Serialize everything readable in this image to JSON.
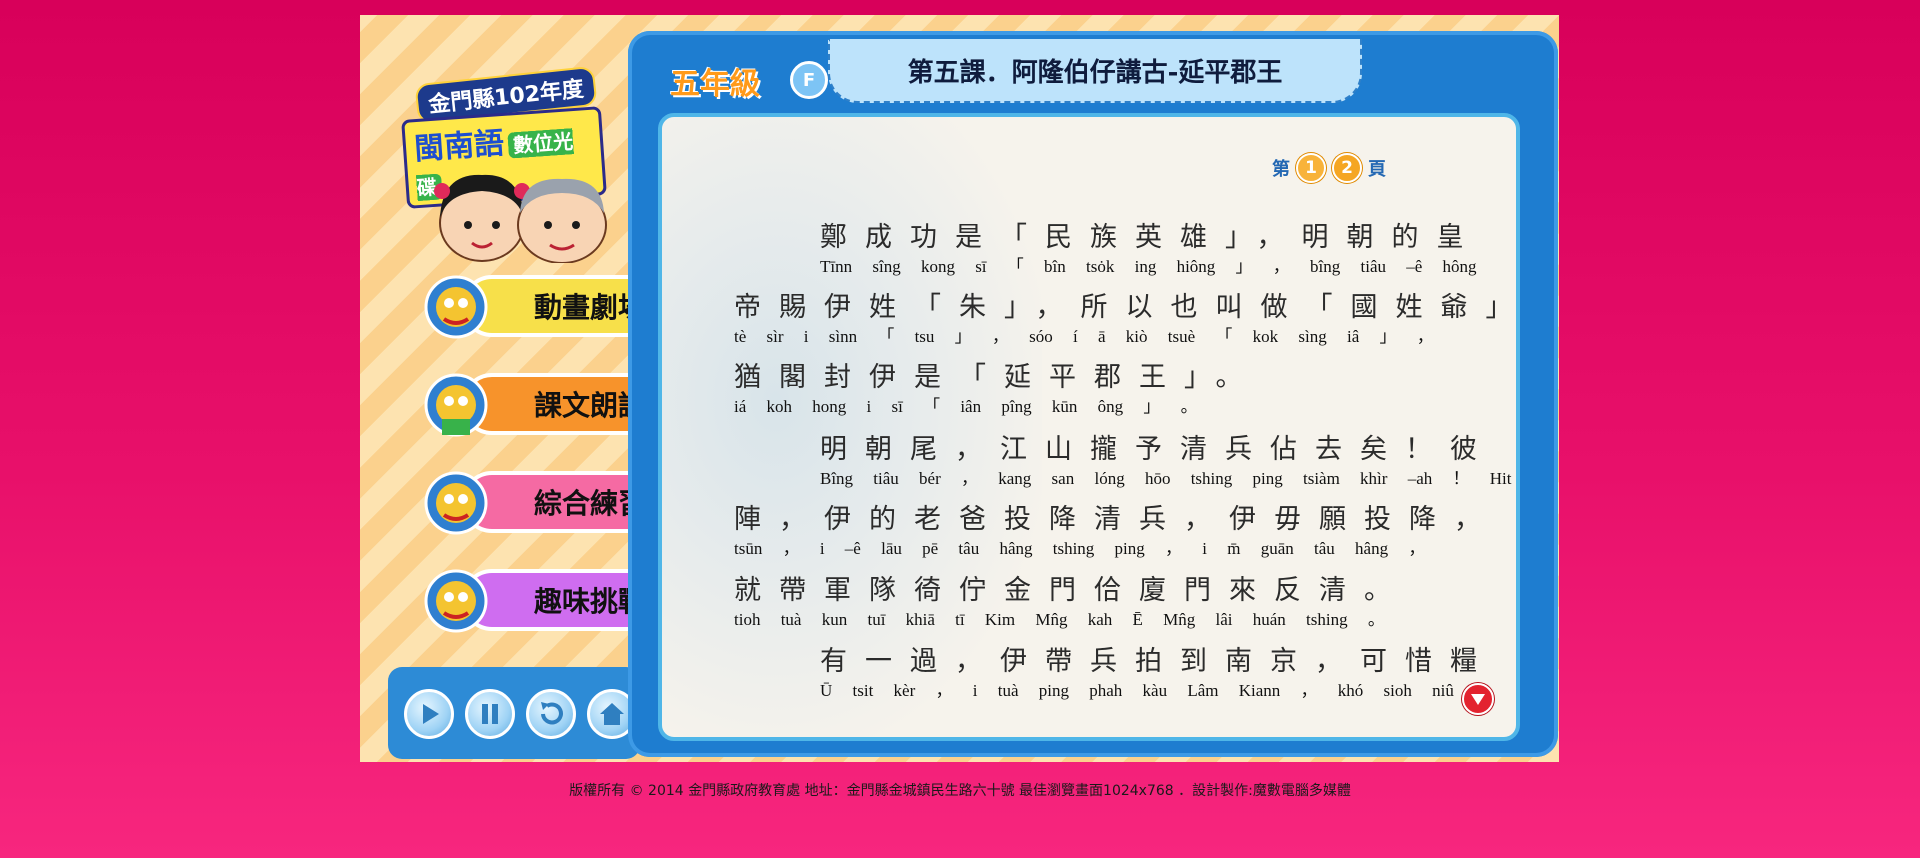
{
  "app": {
    "logo_line1": "金門縣102年度",
    "logo_line2_main": "閩南語",
    "logo_line2_tag": "數位光碟"
  },
  "menu": [
    {
      "label": "動畫劇場",
      "color": "#f7e04a"
    },
    {
      "label": "課文朗讀",
      "color": "#f7932b"
    },
    {
      "label": "綜合練習",
      "color": "#f56aa3"
    },
    {
      "label": "趣味挑戰",
      "color": "#cf6df0"
    }
  ],
  "controls": [
    {
      "icon": "play-icon"
    },
    {
      "icon": "pause-icon"
    },
    {
      "icon": "replay-icon"
    },
    {
      "icon": "home-icon"
    }
  ],
  "lesson": {
    "grade": "五年級",
    "grade_badge": "F",
    "title": "第五課．阿隆伯仔講古-延平郡王"
  },
  "page_indicator": {
    "prefix": "第",
    "pages": [
      "1",
      "2"
    ],
    "current": "1",
    "suffix": "頁"
  },
  "text_lines": [
    {
      "hanzi": "鄭成功是「民族英雄」，明朝的皇",
      "roman": "Tīnn sîng kong sī 「 bîn tsȯk ing hiông 」 ， bîng tiâu –ê hông"
    },
    {
      "hanzi": "帝賜伊姓「朱」，所以也叫做「國姓爺」，",
      "roman": "tè sìr i sìnn 「 tsu 」 ， sóo í ā kiò tsuè 「 kok sìng iâ 」 ，"
    },
    {
      "hanzi": "猶閣封伊是「延平郡王」。",
      "roman": "iá koh hong i sī 「 iân pîng kūn ông 」 。"
    },
    {
      "hanzi": "明朝尾，江山攏予清兵佔去矣！彼",
      "roman": "Bîng tiâu bér ， kang san lóng hōo tshing ping tsiàm khìr –ah ！ Hit"
    },
    {
      "hanzi": "陣，伊的老爸投降清兵，伊毋願投降，",
      "roman": "tsūn ， i –ê lāu pē tâu hâng tshing ping ， i m̄ guān tâu hâng ，"
    },
    {
      "hanzi": "就帶軍隊徛佇金門佮廈門來反清。",
      "roman": "tioh tuà kun tuī khiā tī Kim Mn̂g kah Ē Mn̂g lâi huán tshing 。"
    },
    {
      "hanzi": "有一過，伊帶兵拍到南京，可惜糧",
      "roman": "Ū tsit kèr ， i tuà ping phah kàu Lâm Kiann ， khó sioh niû"
    }
  ],
  "footer": "版權所有 © 2014 金門縣政府教育處  地址：金門縣金城鎮民生路六十號 最佳瀏覽畫面1024x768 ．設計製作:魔數電腦多媒體"
}
